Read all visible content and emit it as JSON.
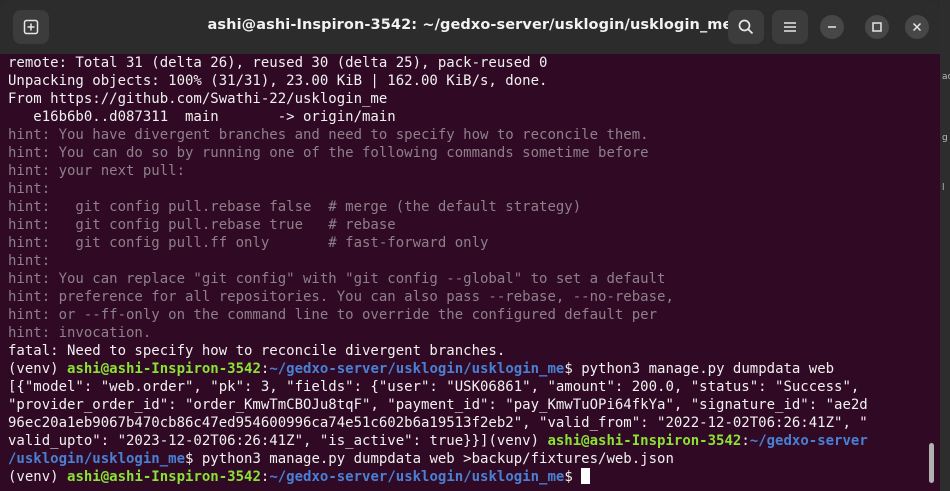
{
  "window": {
    "title": "ashi@ashi-Inspiron-3542: ~/gedxo-server/usklogin/usklogin_me",
    "icons": [
      "new-tab-icon",
      "search-icon",
      "hamburger-menu-icon",
      "minimize-icon",
      "maximize-icon",
      "close-icon"
    ]
  },
  "background": {
    "marks": [
      "ac",
      "g",
      "l"
    ]
  },
  "prompt": {
    "venv": "(venv) ",
    "userhost": "ashi@ashi-Inspiron-3542",
    "colon": ":",
    "path": "~/gedxo-server/usklogin/usklogin_me",
    "dollar": "$ ",
    "path_part1": "~/gedxo-server",
    "path_part2": "/usklogin/usklogin_me"
  },
  "lines": [
    "remote: Total 31 (delta 26), reused 30 (delta 25), pack-reused 0",
    "Unpacking objects: 100% (31/31), 23.00 KiB | 162.00 KiB/s, done.",
    "From https://github.com/Swathi-22/usklogin_me",
    "   e16b6b0..d087311  main       -> origin/main"
  ],
  "hints": [
    "hint: You have divergent branches and need to specify how to reconcile them.",
    "hint: You can do so by running one of the following commands sometime before",
    "hint: your next pull:",
    "hint:",
    "hint:   git config pull.rebase false  # merge (the default strategy)",
    "hint:   git config pull.rebase true   # rebase",
    "hint:   git config pull.ff only       # fast-forward only",
    "hint:",
    "hint: You can replace \"git config\" with \"git config --global\" to set a default",
    "hint: preference for all repositories. You can also pass --rebase, --no-rebase,",
    "hint: or --ff-only on the command line to override the configured default per",
    "hint: invocation."
  ],
  "fatal": "fatal: Need to specify how to reconcile divergent branches.",
  "cmd1": "python3 manage.py dumpdata web",
  "output": [
    "[{\"model\": \"web.order\", \"pk\": 3, \"fields\": {\"user\": \"USK06861\", \"amount\": 200.0, \"status\": \"Success\",",
    "\"provider_order_id\": \"order_KmwTmCBOJu8tqF\", \"payment_id\": \"pay_KmwTuOPi64fkYa\", \"signature_id\": \"ae2d",
    "96ec20a1eb9067b470cb86c47ed954600996ca74e51c602b6a19513f2eb2\", \"valid_from\": \"2022-12-02T06:26:41Z\", \"",
    "valid_upto\": \"2023-12-02T06:26:41Z\", \"is_active\": true}}]"
  ],
  "cmd2": "python3 manage.py dumpdata web >backup/fixtures/web.json"
}
